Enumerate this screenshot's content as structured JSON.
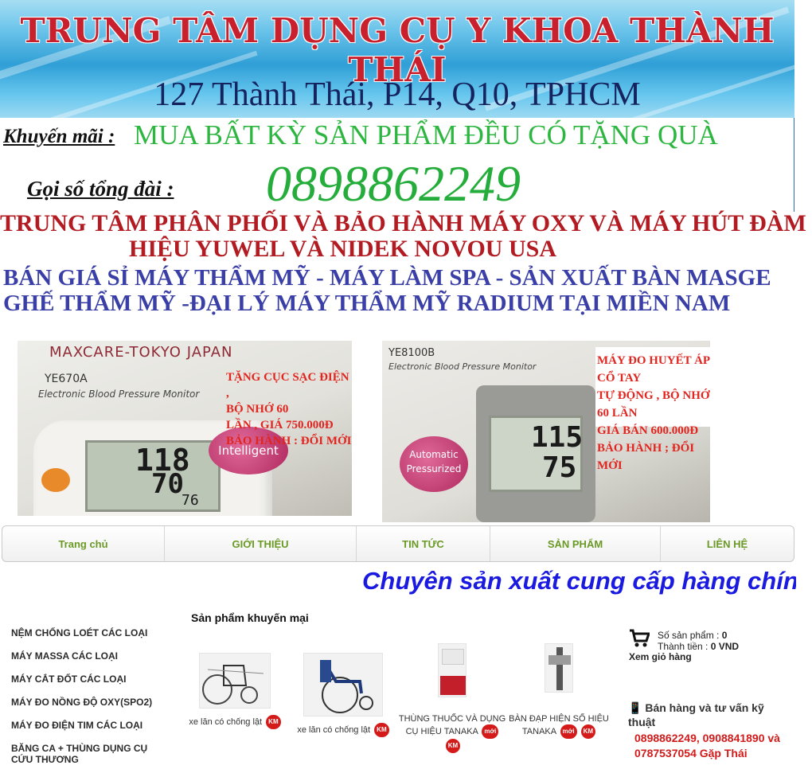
{
  "banner": {
    "title": "TRUNG TÂM DỤNG CỤ Y KHOA THÀNH THÁI",
    "address": "127 Thành Thái, P14, Q10, TPHCM"
  },
  "promo": {
    "label": "Khuyến mãi :",
    "text": "MUA BẤT KỲ SẢN PHẨM ĐỀU CÓ TẶNG QUÀ",
    "call_label": "Gọi số tổng đài :",
    "phone": "0898862249"
  },
  "headlines": {
    "dist_line1": "TRUNG TÂM PHÂN PHỐI VÀ BẢO HÀNH MÁY OXY VÀ MÁY HÚT ĐÀM",
    "dist_line2": "HIỆU YUWEL VÀ NIDEK NOVOU USA",
    "sale_line1": "BÁN GIÁ SỈ MÁY THẨM MỸ - MÁY LÀM  SPA - SẢN XUẤT BÀN MASGE",
    "sale_line2": "GHẾ THẨM MỸ -ĐẠI LÝ MÁY THẨM MỸ RADIUM  TẠI MIỀN NAM"
  },
  "photos": [
    {
      "brand": "MAXCARE-TOKYO JAPAN",
      "model": "YE670A",
      "subtitle": "Electronic Blood Pressure Monitor",
      "badge": "Intelligent",
      "lcd": [
        "118",
        "70",
        "76"
      ],
      "overlay": [
        "TẶNG CỤC SẠC ĐIỆN ,",
        "BỘ NHỚ 60",
        "LẦN , GIÁ 750.000Đ",
        "BẢO HÀNH : ĐỔI MỚI"
      ]
    },
    {
      "model": "YE8100B",
      "subtitle": "Electronic Blood Pressure Monitor",
      "badge": "Automatic Pressurized",
      "lcd": [
        "115",
        "75"
      ],
      "overlay": [
        "MÁY ĐO HUYẾT ÁP CỔ TAY",
        "TỰ ĐỘNG , BỘ NHỚ 60 LẦN",
        "GIÁ BÁN 600.000Đ",
        "BẢO HÀNH ; ĐỔI MỚI"
      ]
    }
  ],
  "nav": [
    "Trang chủ",
    "GIỚI THIỆU",
    "TIN TỨC",
    "SẢN PHẨM",
    "LIÊN HỆ"
  ],
  "marquee": "Chuyên sản xuất cung cấp hàng chính hãng",
  "left_menu": [
    "NỆM CHỐNG LOÉT CÁC LOẠI",
    "MÁY MASSA CÁC LOẠI",
    "MÁY CẮT ĐỐT CÁC LOẠI",
    "MÁY ĐO NỒNG ĐỘ OXY(SPO2)",
    "MÁY ĐO ĐIỆN TIM CÁC LOẠI",
    "BĂNG CA + THÙNG DỤNG CỤ CỨU THƯƠNG"
  ],
  "promo_section": {
    "title": "Sản phẩm khuyến mại",
    "km_label": "KM",
    "new_label": "mới",
    "products": [
      {
        "name": "xe lăn có chống lật"
      },
      {
        "name": "xe lăn có chống lật"
      },
      {
        "name": "THÙNG THUỐC VÀ DỤNG CỤ HIỆU TANAKA"
      },
      {
        "name": "BÀN ĐẠP HIỆN SỐ HIỆU TANAKA"
      }
    ]
  },
  "cart": {
    "count_label": "Số sản phẩm :",
    "count": "0",
    "total_label": "Thành tiền :",
    "total": "0 VND",
    "view_label": "Xem giỏ hàng"
  },
  "support": {
    "title": "Bán hàng và tư vấn kỹ thuật",
    "phones": "0898862249, 0908841890 và 0787537054 Gặp Thái"
  },
  "colors": {
    "banner_title": "#c8202c",
    "promo_green": "#2db640",
    "headline_red": "#b31b22",
    "headline_blue": "#3a3fa8",
    "nav_text": "#6a9a25",
    "marquee_blue": "#1a1ae0",
    "km_badge": "#d51a1a"
  }
}
